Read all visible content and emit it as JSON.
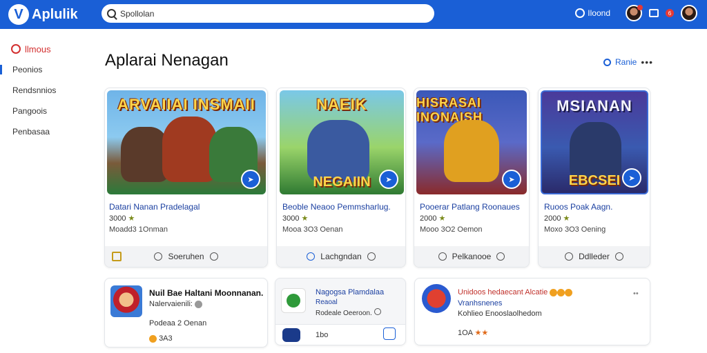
{
  "header": {
    "logo_letter": "V",
    "app_name": "Aplulik",
    "search_value": "Spollolan",
    "nav_label": "Iloond",
    "notif_count": "6"
  },
  "sidebar": {
    "brand": "llmous",
    "items": [
      {
        "label": "Peonios"
      },
      {
        "label": "Rendsnnios"
      },
      {
        "label": "Pangoois"
      },
      {
        "label": "Penbasaa"
      }
    ]
  },
  "main": {
    "title": "Aplarai Nenagan",
    "action_label": "Ranie",
    "more": "•••"
  },
  "cards": [
    {
      "thumb_top": "ARVAIIAI INSMAII",
      "thumb_bottom": "",
      "title": "Datari Nanan Pradelagal",
      "rating": "3000",
      "meta": "Moadd3 1Onman",
      "footer": "Soeruhen",
      "colors": {
        "bg1": "#6fb4e8",
        "bg2": "#2b7a3a"
      }
    },
    {
      "thumb_top": "NAEIK",
      "thumb_bottom": "NEGAIIN",
      "title": "Beoble Neaoo Pemmsharlug.",
      "rating": "3000",
      "meta": "Mooa 3O3 Oenan",
      "footer": "Lachgndan",
      "colors": {
        "bg1": "#9ad46a",
        "bg2": "#2f7a32"
      }
    },
    {
      "thumb_top": "HISRASAI INONAISH",
      "thumb_bottom": "",
      "title": "Pooerar Patlang Roonaues",
      "rating": "2000",
      "meta": "Mooo 3O2 Oemon",
      "footer": "Pelkanooe",
      "colors": {
        "bg1": "#3b58b8",
        "bg2": "#8a2a2a"
      }
    },
    {
      "thumb_top": "MSIANAN",
      "thumb_bottom": "EBCSEI",
      "title": "Ruoos Poak Aagn.",
      "rating": "2000",
      "meta": "Moxo 3O3 Oening",
      "footer": "Ddlleder",
      "colors": {
        "bg1": "#4a3a9a",
        "bg2": "#2a2a6a"
      }
    }
  ],
  "row2": [
    {
      "title": "Nuil Bae Haltani Moonnanan.",
      "sub1": "Nalervaienili:",
      "sub2": "Podeaa 2 Oenan",
      "sub3": "3A3"
    },
    {
      "title": "Nagogsa Plamdalaa",
      "sub1": "Reaoal",
      "sub2": "Rodeale Oeeroon.",
      "sub3": "1bo"
    },
    {
      "title": "Unidoos hedaecant Alcatie",
      "sub1": "Vranhsnenes",
      "sub2": "Kohlieo Enooslaolhedom",
      "sub3": "1OA"
    }
  ],
  "colors": {
    "brand": "#1a5fd6",
    "accent_red": "#d32f2f"
  }
}
